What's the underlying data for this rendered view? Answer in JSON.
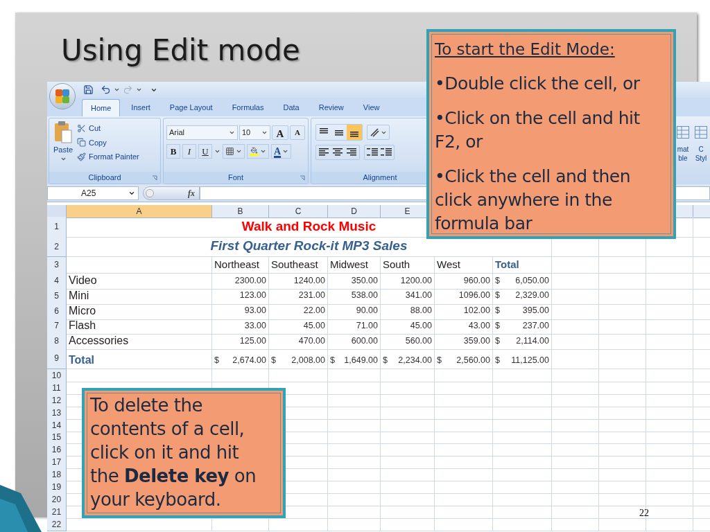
{
  "slide": {
    "title": "Using Edit mode",
    "number": "22"
  },
  "excel": {
    "quick_access": {
      "redo": {
        "disabled": true
      }
    },
    "tabs": [
      {
        "label": "Home",
        "selected": true
      },
      {
        "label": "Insert",
        "selected": false
      },
      {
        "label": "Page Layout",
        "selected": false
      },
      {
        "label": "Formulas",
        "selected": false
      },
      {
        "label": "Data",
        "selected": false
      },
      {
        "label": "Review",
        "selected": false
      },
      {
        "label": "View",
        "selected": false
      }
    ],
    "clipboard": {
      "paste": "Paste",
      "commands": [
        "Cut",
        "Copy",
        "Format Painter"
      ],
      "label": "Clipboard"
    },
    "font": {
      "family": "Arial",
      "size": "10",
      "grow": "A",
      "shrink": "A",
      "bold": "B",
      "italic": "I",
      "underline": "U",
      "color_button": "A",
      "label": "Font"
    },
    "alignment": {
      "vertical": [
        {
          "selected": false
        },
        {
          "selected": false
        },
        {
          "selected": true
        }
      ],
      "label": "Alignment"
    },
    "partial_commands": [
      {
        "line_1": "mat",
        "line_2": "ble"
      },
      {
        "line_1": "C",
        "line_2": "Styl"
      }
    ],
    "name_box": "A25",
    "formula_label": "fx",
    "columns": [
      {
        "letter": "A",
        "selected": true
      },
      {
        "letter": "B",
        "selected": false
      },
      {
        "letter": "C",
        "selected": false
      },
      {
        "letter": "D",
        "selected": false
      },
      {
        "letter": "E",
        "selected": false
      }
    ],
    "rows": [
      {
        "number": "1",
        "kind": "title",
        "text": "Walk and Rock Music"
      },
      {
        "number": "2",
        "kind": "subtitle",
        "text": "First Quarter Rock-it MP3 Sales"
      },
      {
        "number": "3",
        "kind": "header",
        "labels": [
          "Northeast",
          "Southeast",
          "Midwest",
          "South",
          "West"
        ],
        "total_label": "Total"
      },
      {
        "number": "4",
        "kind": "data",
        "label": "Video",
        "values": [
          "2300.00",
          "1240.00",
          "350.00",
          "1200.00",
          "960.00"
        ],
        "total": {
          "currency": "$",
          "amount": "6,050.00"
        }
      },
      {
        "number": "5",
        "kind": "data",
        "label": "Mini",
        "values": [
          "123.00",
          "231.00",
          "538.00",
          "341.00",
          "1096.00"
        ],
        "total": {
          "currency": "$",
          "amount": "2,329.00"
        }
      },
      {
        "number": "6",
        "kind": "data",
        "label": "Micro",
        "values": [
          "93.00",
          "22.00",
          "90.00",
          "88.00",
          "102.00"
        ],
        "total": {
          "currency": "$",
          "amount": "395.00"
        }
      },
      {
        "number": "7",
        "kind": "data",
        "label": "Flash",
        "values": [
          "33.00",
          "45.00",
          "71.00",
          "45.00",
          "43.00"
        ],
        "total": {
          "currency": "$",
          "amount": "237.00"
        }
      },
      {
        "number": "8",
        "kind": "data",
        "label": "Accessories",
        "values": [
          "125.00",
          "470.00",
          "600.00",
          "560.00",
          "359.00"
        ],
        "total": {
          "currency": "$",
          "amount": "2,114.00"
        }
      },
      {
        "number": "9",
        "kind": "total",
        "label": "Total",
        "values": [
          {
            "currency": "$",
            "amount": "2,674.00"
          },
          {
            "currency": "$",
            "amount": "2,008.00"
          },
          {
            "currency": "$",
            "amount": "1,649.00"
          },
          {
            "currency": "$",
            "amount": "2,234.00"
          },
          {
            "currency": "$",
            "amount": "2,560.00"
          },
          {
            "currency": "$",
            "amount": "11,125.00"
          }
        ]
      },
      {
        "number": "10",
        "kind": "empty"
      },
      {
        "number": "11",
        "kind": "empty"
      },
      {
        "number": "12",
        "kind": "empty"
      },
      {
        "number": "13",
        "kind": "empty"
      },
      {
        "number": "14",
        "kind": "empty"
      },
      {
        "number": "15",
        "kind": "empty"
      },
      {
        "number": "16",
        "kind": "empty"
      },
      {
        "number": "17",
        "kind": "empty"
      },
      {
        "number": "18",
        "kind": "empty"
      },
      {
        "number": "19",
        "kind": "empty"
      },
      {
        "number": "20",
        "kind": "empty"
      },
      {
        "number": "21",
        "kind": "empty"
      },
      {
        "number": "22",
        "kind": "empty"
      }
    ]
  },
  "callouts": [
    {
      "heading": "To start the Edit Mode:",
      "paragraphs": [
        "•Double click the cell, or",
        "•Click on the cell and hit F2, or",
        "•Click the cell and then click anywhere in the formula bar"
      ]
    },
    {
      "paragraphs": [
        "To delete the contents of a cell, click on it and hit the **Delete key** on your keyboard."
      ]
    }
  ]
}
